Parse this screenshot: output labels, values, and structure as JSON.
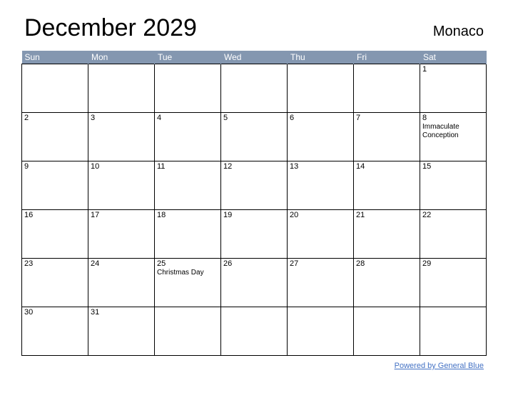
{
  "title": "December 2029",
  "region": "Monaco",
  "weekdays": [
    "Sun",
    "Mon",
    "Tue",
    "Wed",
    "Thu",
    "Fri",
    "Sat"
  ],
  "weeks": [
    [
      {
        "n": "",
        "e": ""
      },
      {
        "n": "",
        "e": ""
      },
      {
        "n": "",
        "e": ""
      },
      {
        "n": "",
        "e": ""
      },
      {
        "n": "",
        "e": ""
      },
      {
        "n": "",
        "e": ""
      },
      {
        "n": "1",
        "e": ""
      }
    ],
    [
      {
        "n": "2",
        "e": ""
      },
      {
        "n": "3",
        "e": ""
      },
      {
        "n": "4",
        "e": ""
      },
      {
        "n": "5",
        "e": ""
      },
      {
        "n": "6",
        "e": ""
      },
      {
        "n": "7",
        "e": ""
      },
      {
        "n": "8",
        "e": "Immaculate Conception"
      }
    ],
    [
      {
        "n": "9",
        "e": ""
      },
      {
        "n": "10",
        "e": ""
      },
      {
        "n": "11",
        "e": ""
      },
      {
        "n": "12",
        "e": ""
      },
      {
        "n": "13",
        "e": ""
      },
      {
        "n": "14",
        "e": ""
      },
      {
        "n": "15",
        "e": ""
      }
    ],
    [
      {
        "n": "16",
        "e": ""
      },
      {
        "n": "17",
        "e": ""
      },
      {
        "n": "18",
        "e": ""
      },
      {
        "n": "19",
        "e": ""
      },
      {
        "n": "20",
        "e": ""
      },
      {
        "n": "21",
        "e": ""
      },
      {
        "n": "22",
        "e": ""
      }
    ],
    [
      {
        "n": "23",
        "e": ""
      },
      {
        "n": "24",
        "e": ""
      },
      {
        "n": "25",
        "e": "Christmas Day"
      },
      {
        "n": "26",
        "e": ""
      },
      {
        "n": "27",
        "e": ""
      },
      {
        "n": "28",
        "e": ""
      },
      {
        "n": "29",
        "e": ""
      }
    ],
    [
      {
        "n": "30",
        "e": ""
      },
      {
        "n": "31",
        "e": ""
      },
      {
        "n": "",
        "e": ""
      },
      {
        "n": "",
        "e": ""
      },
      {
        "n": "",
        "e": ""
      },
      {
        "n": "",
        "e": ""
      },
      {
        "n": "",
        "e": ""
      }
    ]
  ],
  "footer_text": "Powered by General Blue"
}
